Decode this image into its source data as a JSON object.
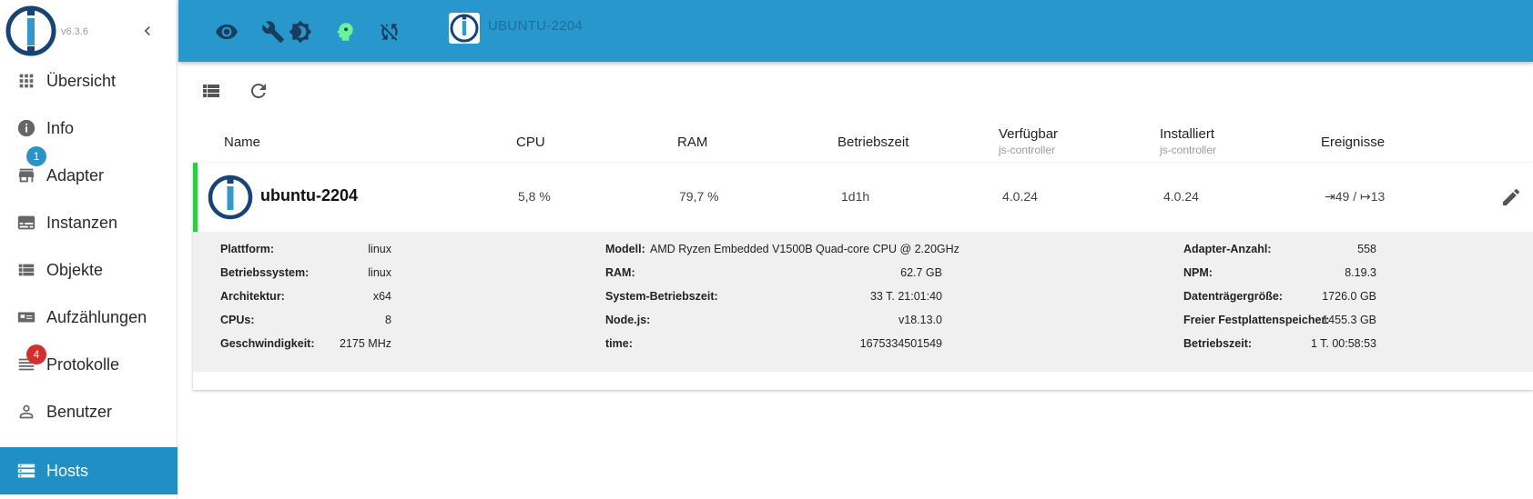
{
  "app": {
    "version": "v6.3.6"
  },
  "sidebar": {
    "items": [
      {
        "label": "Übersicht",
        "icon": "grid-icon"
      },
      {
        "label": "Info",
        "icon": "info-icon"
      },
      {
        "label": "Adapter",
        "icon": "store-icon",
        "badge": "1"
      },
      {
        "label": "Instanzen",
        "icon": "instances-icon"
      },
      {
        "label": "Objekte",
        "icon": "list-icon"
      },
      {
        "label": "Aufzählungen",
        "icon": "enum-icon"
      },
      {
        "label": "Protokolle",
        "icon": "log-icon",
        "badge": "4"
      },
      {
        "label": "Benutzer",
        "icon": "user-icon"
      },
      {
        "label": "Hosts",
        "icon": "hosts-icon",
        "active": true
      }
    ]
  },
  "header": {
    "icons": [
      "eye-icon",
      "wrench-icon",
      "brightness-icon",
      "expert-head-icon",
      "sync-off-icon"
    ],
    "host_title": "UBUNTU-2204",
    "expert_color": "#6cf29a"
  },
  "table": {
    "columns": [
      {
        "label": "Name"
      },
      {
        "label": "CPU"
      },
      {
        "label": "RAM"
      },
      {
        "label": "Betriebszeit"
      },
      {
        "label": "Verfügbar",
        "sub": "js-controller"
      },
      {
        "label": "Installiert",
        "sub": "js-controller"
      },
      {
        "label": "Ereignisse"
      }
    ],
    "host": {
      "name": "ubuntu-2204",
      "cpu": "5,8 %",
      "ram": "79,7 %",
      "uptime": "1d1h",
      "available": "4.0.24",
      "installed": "4.0.24",
      "events": "⇥49 / ↦13",
      "status_color": "#2ecc40"
    },
    "details": {
      "col1": [
        {
          "label": "Plattform:",
          "value": "linux"
        },
        {
          "label": "Betriebssystem:",
          "value": "linux"
        },
        {
          "label": "Architektur:",
          "value": "x64"
        },
        {
          "label": "CPUs:",
          "value": "8"
        },
        {
          "label": "Geschwindigkeit:",
          "value": "2175 MHz"
        }
      ],
      "col2": [
        {
          "label": "Modell:",
          "value": "AMD Ryzen Embedded V1500B Quad-core CPU @ 2.20GHz"
        },
        {
          "label": "RAM:",
          "value": "62.7 GB"
        },
        {
          "label": "System-Betriebszeit:",
          "value": "33 T. 21:01:40"
        },
        {
          "label": "Node.js:",
          "value": "v18.13.0"
        },
        {
          "label": "time:",
          "value": "1675334501549"
        }
      ],
      "col3": [
        {
          "label": "Adapter-Anzahl:",
          "value": "558"
        },
        {
          "label": "NPM:",
          "value": "8.19.3"
        },
        {
          "label": "Datenträgergröße:",
          "value": "1726.0 GB"
        },
        {
          "label": "Freier Festplattenspeicher:",
          "value": "1455.3 GB"
        },
        {
          "label": "Betriebszeit:",
          "value": "1 T. 00:58:53"
        }
      ]
    }
  },
  "colors": {
    "header": "#2898cc",
    "active_nav": "#1f8fc4",
    "badge_blue": "#2b93c7",
    "badge_red": "#d32f2f"
  }
}
